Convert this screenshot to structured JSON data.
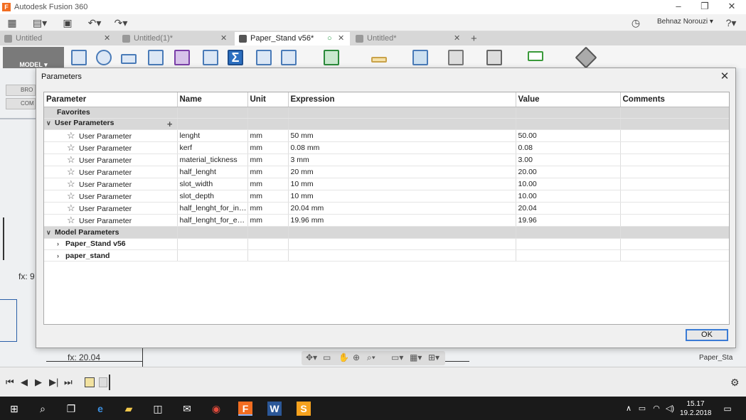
{
  "window": {
    "title": "Autodesk Fusion 360",
    "logo": "F"
  },
  "user": {
    "name": "Behnaz Norouzi ▾"
  },
  "tabs": [
    {
      "label": "Untitled",
      "active": false
    },
    {
      "label": "Untitled(1)*",
      "active": false
    },
    {
      "label": "Paper_Stand v56*",
      "active": true
    },
    {
      "label": "Untitled*",
      "active": false
    }
  ],
  "ribbon": {
    "mode": "MODEL ▾"
  },
  "browser": {
    "items": [
      "BRO",
      "COM"
    ]
  },
  "sketch": {
    "fx1": "fx: 9",
    "fx2": "fx: 20.04",
    "label_right": "Paper_Sta"
  },
  "dialog": {
    "title": "Parameters",
    "ok_label": "OK",
    "columns": [
      "Parameter",
      "Name",
      "Unit",
      "Expression",
      "Value",
      "Comments"
    ],
    "favorites_label": "Favorites",
    "user_params_label": "User Parameters",
    "model_params_label": "Model Parameters",
    "user_params": [
      {
        "type": "User Parameter",
        "name": "lenght",
        "unit": "mm",
        "expression": "50 mm",
        "value": "50.00"
      },
      {
        "type": "User Parameter",
        "name": "kerf",
        "unit": "mm",
        "expression": "0.08 mm",
        "value": "0.08"
      },
      {
        "type": "User Parameter",
        "name": "material_tickness",
        "unit": "mm",
        "expression": "3 mm",
        "value": "3.00"
      },
      {
        "type": "User Parameter",
        "name": "half_lenght",
        "unit": "mm",
        "expression": "20 mm",
        "value": "20.00"
      },
      {
        "type": "User Parameter",
        "name": "slot_width",
        "unit": "mm",
        "expression": "10 mm",
        "value": "10.00"
      },
      {
        "type": "User Parameter",
        "name": "slot_depth",
        "unit": "mm",
        "expression": "10 mm",
        "value": "10.00"
      },
      {
        "type": "User Parameter",
        "name": "half_lenght_for_inte...",
        "unit": "mm",
        "expression": "20.04 mm",
        "value": "20.04"
      },
      {
        "type": "User Parameter",
        "name": "half_lenght_for_ext...",
        "unit": "mm",
        "expression": "19.96 mm",
        "value": "19.96"
      }
    ],
    "model_children": [
      "Paper_Stand v56",
      "paper_stand"
    ]
  },
  "clock": {
    "time": "15.17",
    "date": "19.2.2018"
  }
}
